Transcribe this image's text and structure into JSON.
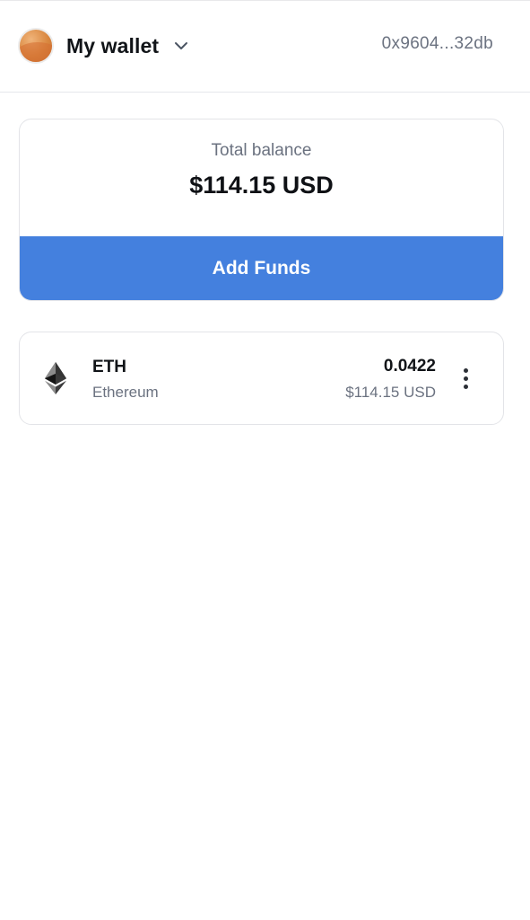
{
  "header": {
    "wallet_name": "My wallet",
    "address": "0x9604...32db"
  },
  "balance": {
    "label": "Total balance",
    "value": "$114.15 USD",
    "add_funds_label": "Add Funds"
  },
  "assets": [
    {
      "symbol": "ETH",
      "name": "Ethereum",
      "amount": "0.0422",
      "fiat_value": "$114.15 USD",
      "icon": "ethereum-icon"
    }
  ],
  "colors": {
    "accent": "#4480de",
    "text_primary": "#111418",
    "text_secondary": "#6b7280",
    "border": "#e3e4e8"
  }
}
